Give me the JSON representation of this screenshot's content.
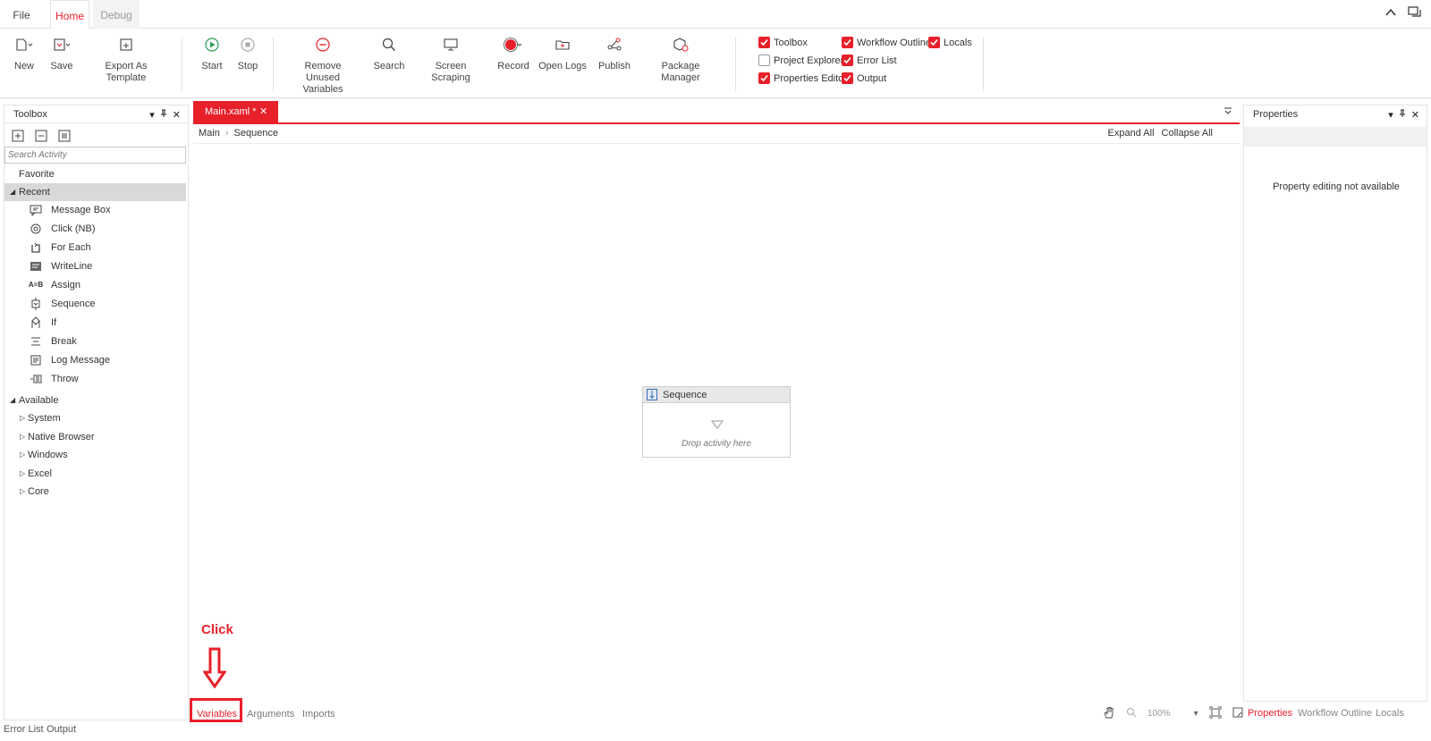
{
  "menu_tabs": [
    {
      "label": "File"
    },
    {
      "label": "Home"
    },
    {
      "label": "Debug"
    }
  ],
  "ribbon": {
    "new": "New",
    "save": "Save",
    "export_template": "Export As Template",
    "start": "Start",
    "stop": "Stop",
    "remove_unused": "Remove Unused Variables",
    "search": "Search",
    "screen_scraping": "Screen Scraping",
    "record": "Record",
    "open_logs": "Open Logs",
    "publish": "Publish",
    "package_manager": "Package Manager",
    "panels": [
      {
        "label": "Toolbox",
        "checked": true
      },
      {
        "label": "Project Explorer",
        "checked": false
      },
      {
        "label": "Properties Editor",
        "checked": true
      },
      {
        "label": "Workflow Outline",
        "checked": true
      },
      {
        "label": "Error List",
        "checked": true
      },
      {
        "label": "Output",
        "checked": true
      },
      {
        "label": "Locals",
        "checked": true
      }
    ]
  },
  "toolbox": {
    "title": "Toolbox",
    "search_placeholder": "Search Activity",
    "favorite": "Favorite",
    "recent_label": "Recent",
    "recent": [
      {
        "label": "Message Box",
        "icon": "message-box-icon"
      },
      {
        "label": "Click (NB)",
        "icon": "click-icon"
      },
      {
        "label": "For Each",
        "icon": "for-each-icon"
      },
      {
        "label": "WriteLine",
        "icon": "writeline-icon"
      },
      {
        "label": "Assign",
        "icon": "assign-icon"
      },
      {
        "label": "Sequence",
        "icon": "sequence-icon"
      },
      {
        "label": "If",
        "icon": "if-icon"
      },
      {
        "label": "Break",
        "icon": "break-icon"
      },
      {
        "label": "Log Message",
        "icon": "log-message-icon"
      },
      {
        "label": "Throw",
        "icon": "throw-icon"
      }
    ],
    "available_label": "Available",
    "available": [
      "System",
      "Native Browser",
      "Windows",
      "Excel",
      "Core"
    ]
  },
  "document": {
    "tab_label": "Main.xaml *",
    "breadcrumb": [
      "Main",
      "Sequence"
    ],
    "expand_all": "Expand All",
    "collapse_all": "Collapse All",
    "sequence_title": "Sequence",
    "drop_hint": "Drop activity here",
    "bottom_tabs": [
      "Variables",
      "Arguments",
      "Imports"
    ],
    "zoom": "100%"
  },
  "properties": {
    "title": "Properties",
    "empty_text": "Property editing not available",
    "tabs": [
      "Properties",
      "Workflow Outline",
      "Locals"
    ]
  },
  "status_tabs": [
    "Error List",
    "Output"
  ],
  "annotation": {
    "label": "Click",
    "color": "#e8202a"
  },
  "colors": {
    "accent": "#e8202a",
    "start_green": "#2e9e4f"
  }
}
